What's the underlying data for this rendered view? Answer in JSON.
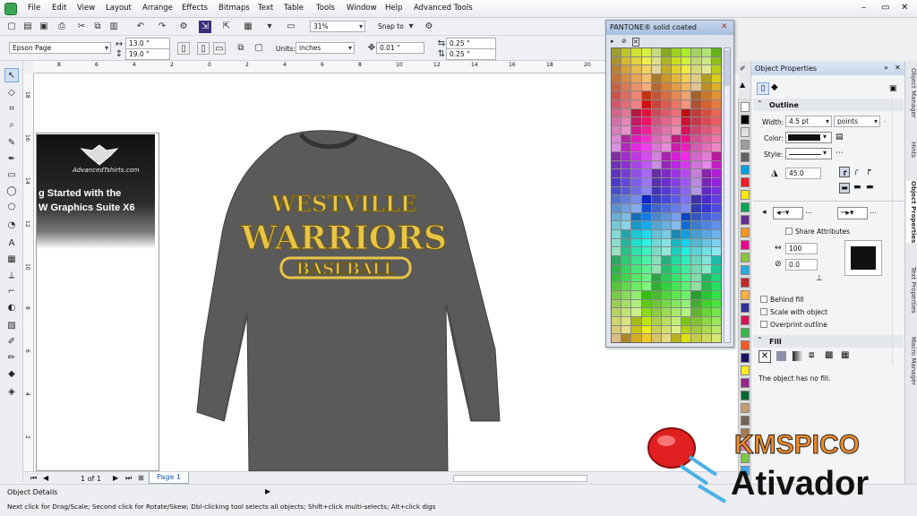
{
  "menubar": {
    "items": [
      "File",
      "Edit",
      "View",
      "Layout",
      "Arrange",
      "Effects",
      "Bitmaps",
      "Text",
      "Table",
      "Tools",
      "Window",
      "Help",
      "Advanced Tools"
    ],
    "window_controls": [
      "–",
      "▭",
      "✕"
    ]
  },
  "std_toolbar": {
    "zoom": "31%",
    "snap_to": "Snap to"
  },
  "prop_bar": {
    "page_preset": "Epson Page",
    "width": "13.0 \"",
    "height": "19.0 \"",
    "units_label": "Units:",
    "units": "inches",
    "nudge": "0.01 \"",
    "dup_x": "0.25 \"",
    "dup_y": "0.25 \""
  },
  "ruler": {
    "h_ticks": [
      "8",
      "6",
      "4",
      "2",
      "0",
      "2",
      "4",
      "6",
      "8",
      "10",
      "12",
      "14",
      "16",
      "18",
      "20"
    ],
    "v_ticks": [
      "18",
      "16",
      "14",
      "12",
      "10",
      "8",
      "6",
      "4",
      "2"
    ]
  },
  "canvas": {
    "promo_logo": "AdvancedTshirts.com",
    "promo_line1": "g Started with the",
    "promo_line2": "W Graphics Suite X6",
    "shirt_line1": "WESTVILLE",
    "shirt_line2": "WARRIORS",
    "shirt_line3": "BASEBALL"
  },
  "page_nav": {
    "count": "1 of 1",
    "tab": "Page 1"
  },
  "status": {
    "object_details": "Object Details",
    "hint": "Next click for Drag/Scale; Second click for Rotate/Skew; Dbl-clicking tool selects all objects; Shift+click multi-selects; Alt+click digs"
  },
  "pantone": {
    "title": "PANTONE® solid coated"
  },
  "object_properties": {
    "title": "Object Properties",
    "outline_header": "Outline",
    "width_label": "Width:",
    "width_value": "4.5 pt",
    "width_unit": "points",
    "color_label": "Color:",
    "color_value": "#111111",
    "style_label": "Style:",
    "angle_value": "45.0",
    "share_attributes": "Share Attributes",
    "stretch_value": "100",
    "angle2_value": "0.0",
    "behind_fill": "Behind fill",
    "scale_with_object": "Scale with object",
    "overprint_outline": "Overprint outline",
    "fill_header": "Fill",
    "fill_message": "The object has no fill."
  },
  "dock_tabs": [
    "Object Manager",
    "Hints",
    "Object Properties",
    "Text Properties",
    "Macro Manager"
  ],
  "watermark": {
    "line1": "KMSPICO",
    "line2": "Ativador"
  },
  "colors": {
    "accent": "#1c5fb8",
    "shirt": "#5a5a5a",
    "lettering": "#e8c547"
  }
}
